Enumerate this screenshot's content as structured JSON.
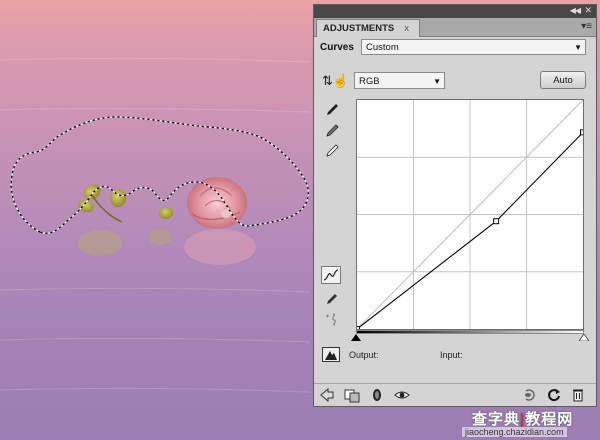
{
  "panel": {
    "tab_label": "ADJUSTMENTS",
    "tab_close": "x",
    "preset_label": "Curves",
    "preset_value": "Custom",
    "channel_value": "RGB",
    "auto_button": "Auto",
    "output_label": "Output:",
    "input_label": "Input:"
  },
  "curve": {
    "control_points": [
      [
        0,
        0
      ],
      [
        157,
        120
      ],
      [
        255,
        219
      ]
    ]
  },
  "watermark": {
    "logo_left": "查字典",
    "logo_right": "教程网",
    "url": "jiaocheng.chazidian.com"
  },
  "colors": {
    "panel_bg": "#d4d4d4",
    "graph_bg": "#ffffff",
    "curve": "#000000"
  }
}
